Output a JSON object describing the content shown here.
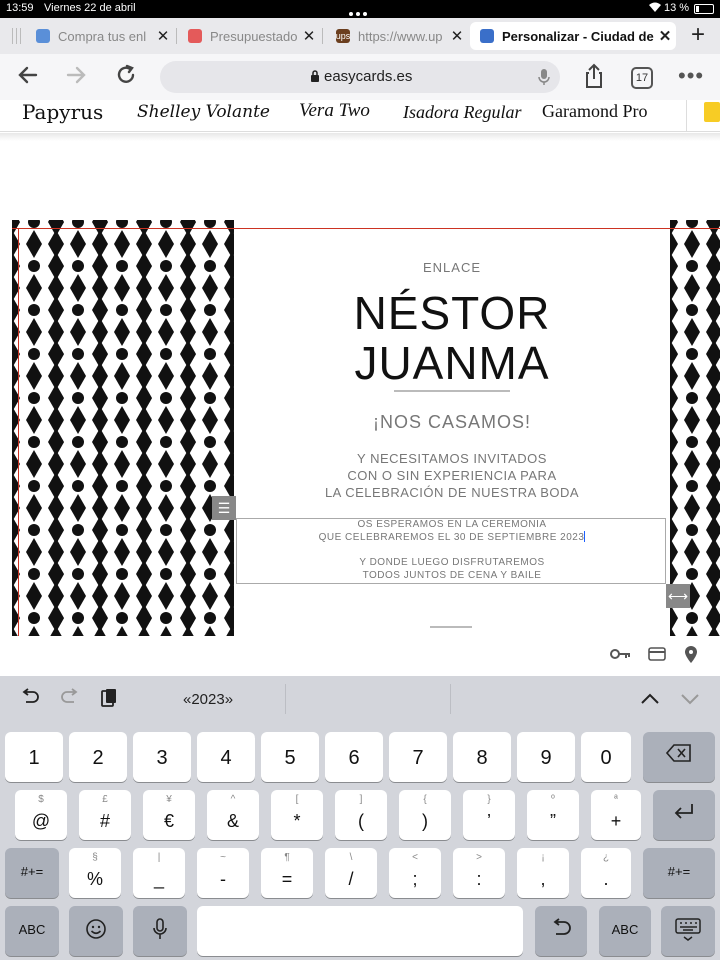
{
  "status": {
    "time": "13:59",
    "date": "Viernes 22 de abril",
    "battery": "13 %"
  },
  "tabs": [
    {
      "title": "Compra tus enl",
      "favicon_color": "#5a8fd8",
      "active": false
    },
    {
      "title": "Presupuestado",
      "favicon_color": "#e45a5a",
      "active": false
    },
    {
      "title": "https://www.up",
      "favicon_color": "#6b3e1e",
      "favicon_text": "ups",
      "active": false
    },
    {
      "title": "Personalizar - Ciudad de",
      "favicon_color": "#3a6fc9",
      "active": true
    }
  ],
  "nav": {
    "url": "easycards.es",
    "tab_count": "17"
  },
  "fonts": [
    "Papyrus",
    "Shelley Volante",
    "Vera Two",
    "Isadora Regular",
    "Garamond Pro"
  ],
  "card": {
    "eyebrow": "ENLACE",
    "name1": "NÉSTOR",
    "name2": "JUANMA",
    "subtitle": "¡NOS CASAMOS!",
    "p1_line1": "Y NECESITAMOS INVITADOS",
    "p1_line2": "CON O SIN EXPERIENCIA PARA",
    "p1_line3": "LA CELEBRACIÓN DE NUESTRA BODA",
    "p2_line1": "OS ESPERAMOS EN LA CEREMONIA",
    "p2_line2": "QUE CELEBRAREMOS EL 30 DE SEPTIEMBRE 2023",
    "p3_line1": "Y DONDE LUEGO DISFRUTAREMOS",
    "p3_line2": "TODOS JUNTOS DE CENA Y BAILE"
  },
  "keyboard": {
    "suggestion": "«2023»",
    "row1": [
      "1",
      "2",
      "3",
      "4",
      "5",
      "6",
      "7",
      "8",
      "9",
      "0"
    ],
    "row2": [
      {
        "main": "@",
        "hint": "$"
      },
      {
        "main": "#",
        "hint": "£"
      },
      {
        "main": "€",
        "hint": "¥"
      },
      {
        "main": "&",
        "hint": "^"
      },
      {
        "main": "*",
        "hint": "["
      },
      {
        "main": "(",
        "hint": "]"
      },
      {
        "main": ")",
        "hint": "{"
      },
      {
        "main": "’",
        "hint": "}"
      },
      {
        "main": "”",
        "hint": "º"
      },
      {
        "main": "+",
        "hint": "ª"
      }
    ],
    "row3": [
      {
        "main": "%",
        "hint": "§"
      },
      {
        "main": "_",
        "hint": "|"
      },
      {
        "main": "-",
        "hint": "~"
      },
      {
        "main": "=",
        "hint": "¶"
      },
      {
        "main": "/",
        "hint": "\\"
      },
      {
        "main": ";",
        "hint": "<"
      },
      {
        "main": ":",
        "hint": ">"
      },
      {
        "main": ",",
        "hint": "¡"
      },
      {
        "main": ".",
        "hint": "¿"
      }
    ],
    "symbols_label": "#+=",
    "abc_label": "ABC"
  }
}
